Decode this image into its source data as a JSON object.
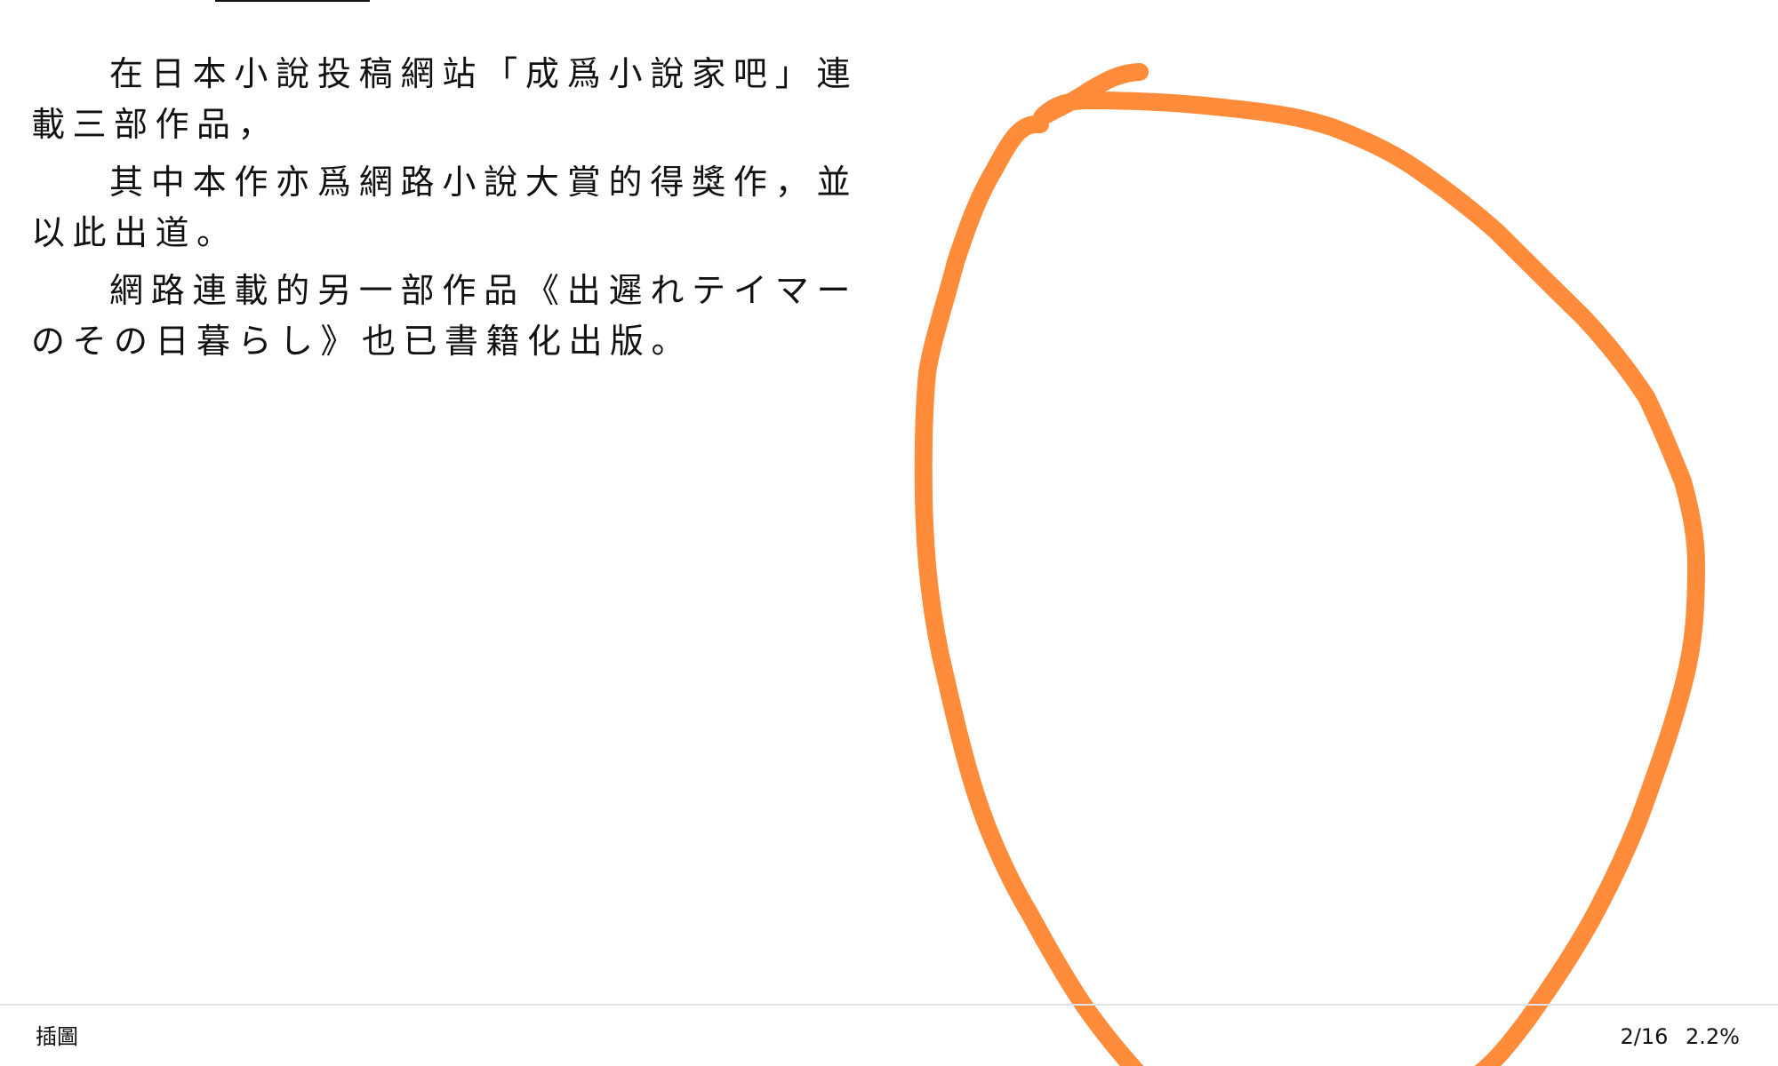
{
  "reader": {
    "paragraphs": [
      "在日本小說投稿網站「成爲小說家吧」連載三部作品，",
      "其中本作亦爲網路小說大賞的得獎作，並以此出道。",
      "網路連載的另一部作品《出遲れテイマーのその日暮らし》也已書籍化出版。"
    ]
  },
  "footer": {
    "chapter": "插圖",
    "page": "2/16",
    "progress": "2.2%"
  },
  "annotation": {
    "color": "#FF8C3B",
    "shape": "hand-drawn-loop"
  }
}
